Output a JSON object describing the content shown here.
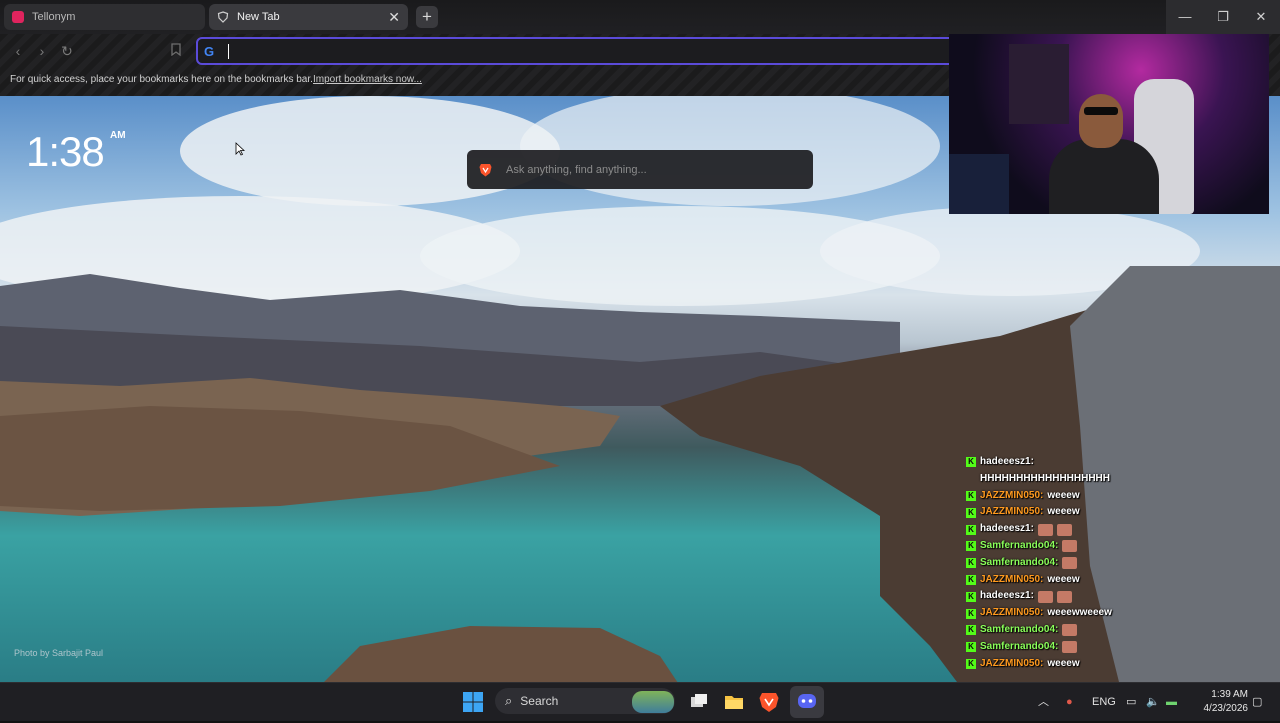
{
  "tabs": [
    {
      "title": "Tellonym",
      "close_label": ""
    },
    {
      "title": "New Tab",
      "close_label": "✕"
    }
  ],
  "window_controls": {
    "minimize": "—",
    "maximize": "❐",
    "close": "✕"
  },
  "omnibox": {
    "value": "",
    "engine_icon": "google-icon"
  },
  "bookmarks_bar": {
    "text": "For quick access, place your bookmarks here on the bookmarks bar.",
    "link": "Import bookmarks now..."
  },
  "new_tab_page": {
    "clock_time": "1:38",
    "clock_ampm": "AM",
    "search_placeholder": "Ask anything, find anything...",
    "photo_credit": "Photo by Sarbajit Paul"
  },
  "chat": [
    {
      "user": "hadeeesz1:",
      "color": "#ffffff",
      "message": "",
      "continuation": "HHHHHHHHHHHHHHHHHH",
      "emotes": 0
    },
    {
      "user": "JAZZMIN050:",
      "color": "#ff9a1f",
      "message": "weeew",
      "emotes": 0
    },
    {
      "user": "JAZZMIN050:",
      "color": "#ff9a1f",
      "message": "weeew",
      "emotes": 0
    },
    {
      "user": "hadeeesz1:",
      "color": "#ffffff",
      "message": "",
      "emotes": 2
    },
    {
      "user": "Samfernando04:",
      "color": "#8bff5a",
      "message": "",
      "emotes": 1
    },
    {
      "user": "Samfernando04:",
      "color": "#8bff5a",
      "message": "",
      "emotes": 1
    },
    {
      "user": "JAZZMIN050:",
      "color": "#ff9a1f",
      "message": "weeew",
      "emotes": 0
    },
    {
      "user": "hadeeesz1:",
      "color": "#ffffff",
      "message": "",
      "emotes": 2
    },
    {
      "user": "JAZZMIN050:",
      "color": "#ff9a1f",
      "message": "weeewweeew",
      "emotes": 0
    },
    {
      "user": "Samfernando04:",
      "color": "#8bff5a",
      "message": "",
      "emotes": 1
    },
    {
      "user": "Samfernando04:",
      "color": "#8bff5a",
      "message": "",
      "emotes": 1
    },
    {
      "user": "JAZZMIN050:",
      "color": "#ff9a1f",
      "message": "weeew",
      "emotes": 0
    }
  ],
  "taskbar": {
    "search_label": "Search",
    "language": "ENG",
    "time": "1:39 AM",
    "date": "4/23/2026"
  },
  "colors": {
    "accent": "#5b4bd9",
    "kick_green": "#53fc18",
    "brave_orange": "#fb542b"
  }
}
